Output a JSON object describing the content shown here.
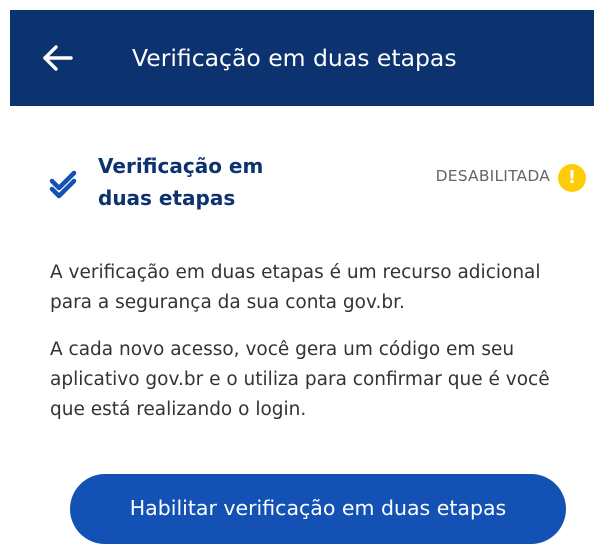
{
  "app_bar": {
    "title": "Verificação em duas etapas",
    "back_icon": "arrow-left-icon",
    "background": "#0c326f"
  },
  "feature": {
    "title": "Verificação em duas etapas",
    "status": "DESABILITADA",
    "status_icon": "warning-exclamation-icon",
    "status_icon_symbol": "!",
    "status_icon_color": "#ffcd07",
    "check_icon": "double-check-icon"
  },
  "description": {
    "paragraph_1": "A verificação em duas etapas é um recurso adicional para a segurança da sua conta gov.br.",
    "paragraph_2": "A cada novo acesso, você gera um código em seu aplicativo gov.br e o utiliza para confirmar que é você que está realizando o login."
  },
  "actions": {
    "enable_label": "Habilitar verificação em duas etapas",
    "button_color": "#1351b4"
  }
}
